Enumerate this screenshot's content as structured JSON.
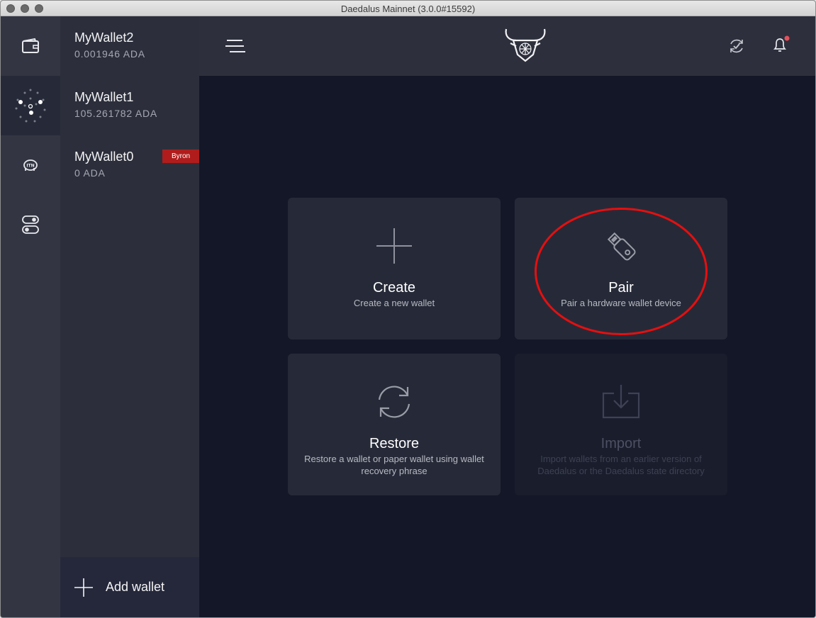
{
  "window": {
    "title": "Daedalus Mainnet (3.0.0#15592)"
  },
  "rail": {
    "items": [
      {
        "icon": "wallet-icon"
      },
      {
        "icon": "network-icon"
      },
      {
        "icon": "itn-piggy-icon"
      },
      {
        "icon": "settings-toggle-icon"
      }
    ]
  },
  "wallets": [
    {
      "name": "MyWallet2",
      "balance": "0.001946 ADA"
    },
    {
      "name": "MyWallet1",
      "balance": "105.261782 ADA"
    },
    {
      "name": "MyWallet0",
      "balance": "0 ADA",
      "badge": "Byron"
    }
  ],
  "add_wallet": {
    "label": "Add wallet"
  },
  "topbar": {
    "menu_icon": "hamburger-icon",
    "logo": "daedalus-logo",
    "sync_icon": "sync-check-icon",
    "notifications_icon": "bell-icon"
  },
  "tiles": {
    "create": {
      "title": "Create",
      "desc": "Create a new wallet"
    },
    "pair": {
      "title": "Pair",
      "desc": "Pair a hardware wallet device"
    },
    "restore": {
      "title": "Restore",
      "desc": "Restore a wallet or paper wallet using wallet recovery phrase"
    },
    "import": {
      "title": "Import",
      "desc": "Import wallets from an earlier version of Daedalus or the Daedalus state directory"
    }
  },
  "colors": {
    "accent_red": "#e60f0f",
    "byron_badge": "#b01c1c",
    "notification_dot": "#e5505b"
  }
}
